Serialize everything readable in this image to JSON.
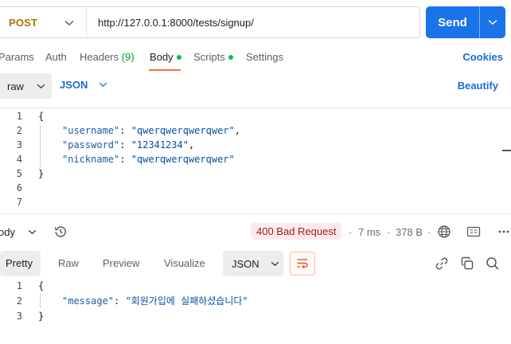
{
  "request": {
    "method": "POST",
    "url": "http://127.0.0.1:8000/tests/signup/",
    "send_label": "Send"
  },
  "tabs": {
    "params": "Params",
    "auth": "Auth",
    "headers": "Headers",
    "headers_count": "(9)",
    "body": "Body",
    "scripts": "Scripts",
    "settings": "Settings",
    "cookies": "Cookies"
  },
  "body_options": {
    "mode": "raw",
    "format": "JSON",
    "beautify": "Beautify"
  },
  "request_body": {
    "line_numbers": [
      "1",
      "2",
      "3",
      "4",
      "5",
      "6",
      "7"
    ],
    "open_brace": "{",
    "close_brace": "}",
    "fields": [
      {
        "key": "\"username\"",
        "value": "\"qwerqwerqwerqwer\"",
        "trail": ","
      },
      {
        "key": "\"password\"",
        "value": "\"12341234\"",
        "trail": ","
      },
      {
        "key": "\"nickname\"",
        "value": "\"qwerqwerqwerqwer\"",
        "trail": ""
      }
    ]
  },
  "response": {
    "section_label": "ody",
    "status": "400 Bad Request",
    "time": "7 ms",
    "size": "378 B",
    "view_tabs": [
      "Pretty",
      "Raw",
      "Preview",
      "Visualize"
    ],
    "format": "JSON",
    "line_numbers": [
      "1",
      "2",
      "3"
    ],
    "open_brace": "{",
    "close_brace": "}",
    "key": "\"message\"",
    "value": "\"회원가입에 실패하셨습니다\""
  },
  "colors": {
    "accent": "#1a73e8",
    "method": "#a8730b",
    "tab_indicator": "#ff6c37",
    "status_error_bg": "#fdeaea",
    "status_error_text": "#9e1c1c"
  },
  "icons": [
    "chevron-down-icon",
    "history-icon",
    "globe-icon",
    "save-response-icon",
    "more-icon",
    "wrap-lines-icon",
    "link-icon",
    "copy-icon",
    "search-icon"
  ]
}
